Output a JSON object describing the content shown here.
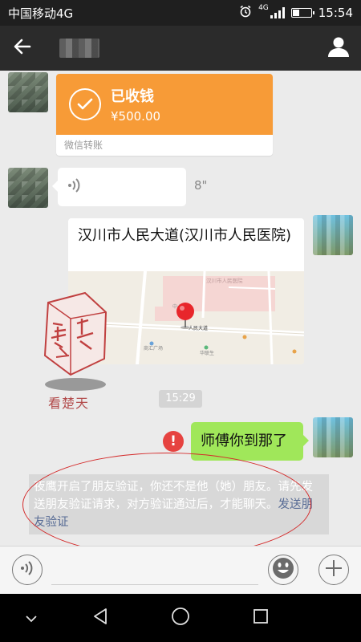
{
  "status_bar": {
    "carrier": "中国移动4G",
    "network_badge": "4G",
    "time": "15:54",
    "battery_level": 0.35,
    "icons": [
      "alarm-icon",
      "signal-icon",
      "battery-icon"
    ]
  },
  "title_bar": {
    "icons": [
      "back-arrow-icon",
      "profile-icon"
    ]
  },
  "messages": {
    "transfer": {
      "title": "已收钱",
      "amount": "¥500.00",
      "footer": "微信转账",
      "icon": "check-circle-icon",
      "color": "#f79b37"
    },
    "voice": {
      "duration": "8\"",
      "icon": "voice-wave-icon"
    },
    "location": {
      "title": "汉川市人民大道(汉川市人民医院)",
      "map_labels": {
        "hospital": "汉川市人民医院",
        "center": "中心",
        "road": "人民大道",
        "plaza": "商汇广场",
        "shop": "华联生"
      },
      "pin_color": "#e8262b"
    },
    "watermark": {
      "caption": "看楚天"
    },
    "time_stamp": "15:29",
    "sent": {
      "text": "师傅你到那了",
      "error_mark": "!",
      "bubble_color": "#a0e75a"
    },
    "notice": {
      "text": "夜鹰开启了朋友验证，你还不是他（她）朋友。请先发送朋友验证请求，对方验证通过后，才能聊天。",
      "link": "发送朋友验证",
      "link_color": "#576b95"
    }
  },
  "input_bar": {
    "text_value": "",
    "icons": [
      "voice-mode-icon",
      "emoji-icon",
      "plus-icon"
    ]
  },
  "nav_bar": {
    "icons": [
      "chevron-down-icon",
      "back-triangle-icon",
      "home-circle-icon",
      "recents-square-icon"
    ]
  }
}
